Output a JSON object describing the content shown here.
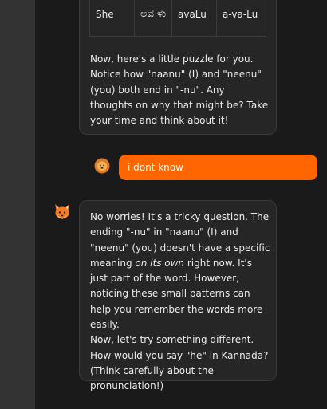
{
  "table": {
    "row": [
      "She",
      "ಅವ ಳು",
      "avaLu",
      "a-va-Lu"
    ]
  },
  "messages": {
    "puzzle_text": "Now, here's a little puzzle for you. Notice how \"naanu\" (I) and \"neenu\" (you) both end in \"-nu\". Any thoughts on why that might be? Take your time and think about it!",
    "user_reply": "i dont know",
    "reply_part1": "No worries! It's a tricky question. The ending \"-nu\" in \"naanu\" (I) and \"neenu\" (you) doesn't have a specific meaning ",
    "reply_emphasis": "on its own",
    "reply_part2": " right now. It's just part of the word. However, noticing these small patterns can help you remember the words more easily.",
    "reply_part3": "Now, let's try something different. How would you say \"he\" in Kannada? (Think carefully about the pronunciation!)"
  },
  "colors": {
    "accent": "#ff6600",
    "background": "#1a1a1a",
    "bubble": "#262626",
    "sidebar": "#333333"
  },
  "icons": {
    "user_avatar": "lion-icon",
    "assistant_avatar": "fox-icon"
  }
}
